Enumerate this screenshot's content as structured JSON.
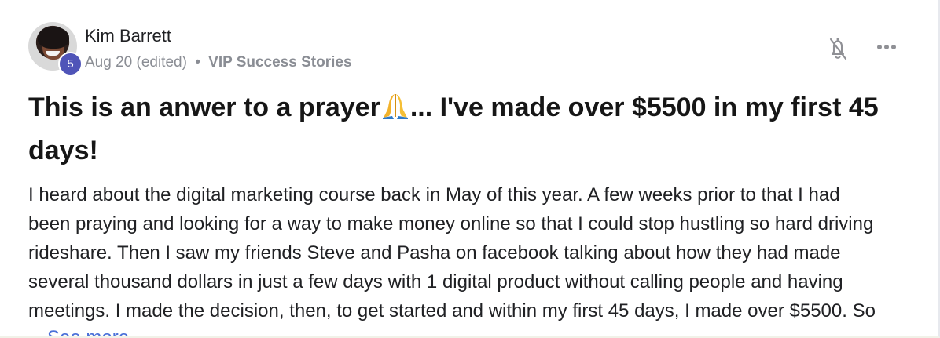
{
  "post": {
    "author": "Kim Barrett",
    "level_badge": "5",
    "date": "Aug 20 (edited)",
    "separator": "•",
    "category": "VIP Success Stories",
    "title_before_emoji": "This is an anwer to a prayer",
    "title_emoji": "praying-hands",
    "title_after_emoji": "... I've made over $5500 in my first 45 days!",
    "body": "I heard about the digital marketing course back in May of this year. A few weeks prior to that I had\nbeen praying and looking for a way to make money online so that I could stop hustling so hard driving\nrideshare. Then I saw my friends Steve and Pasha on facebook talking about how they had made\nseveral thousand dollars in just a few days with 1 digital product without calling people and having\nmeetings. I made the decision, then, to get started and within my first 45 days, I made over $5500. So",
    "see_more_label": "See more"
  },
  "icons": {
    "notification": "bell-off-icon",
    "menu": "more-horizontal-icon"
  },
  "colors": {
    "badge": "#4f54b8",
    "muted_text": "#8a8d94",
    "link": "#4a70d8",
    "title_text": "#161616"
  }
}
